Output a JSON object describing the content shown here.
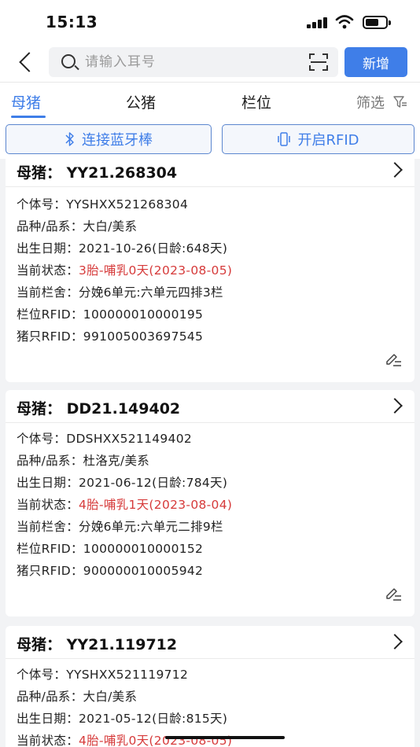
{
  "status_bar": {
    "time": "15:13"
  },
  "search": {
    "placeholder": "请输入耳号",
    "add_label": "新增"
  },
  "tabs": {
    "items": [
      "母猪",
      "公猪",
      "栏位"
    ],
    "active": "母猪",
    "filter_label": "筛选"
  },
  "actions": {
    "bluetooth_label": "连接蓝牙棒",
    "rfid_label": "开启RFID"
  },
  "colors": {
    "accent": "#3f7ee8",
    "status_red": "#d63a3a"
  },
  "labels": {
    "id": "个体号：",
    "breed": "品种/品系：",
    "birth": "出生日期：",
    "status": "当前状态：",
    "pen": "当前栏舍：",
    "pen_rfid": "栏位RFID：",
    "pig_rfid": "猪只RFID："
  },
  "cards": [
    {
      "title": "母猪：  YY21.268304",
      "id": "YYSHXX521268304",
      "breed": "大白/美系",
      "birth": "2021-10-26(日龄:648天)",
      "status": "3胎-哺乳0天(2023-08-05)",
      "pen": "分娩6单元:六单元四排3栏",
      "pen_rfid": "100000010000195",
      "pig_rfid": "991005003697545"
    },
    {
      "title": "母猪：  DD21.149402",
      "id": "DDSHXX521149402",
      "breed": "杜洛克/美系",
      "birth": "2021-06-12(日龄:784天)",
      "status": "4胎-哺乳1天(2023-08-04)",
      "pen": "分娩6单元:六单元二排9栏",
      "pen_rfid": "100000010000152",
      "pig_rfid": "900000010005942"
    },
    {
      "title": "母猪：  YY21.119712",
      "id": "YYSHXX521119712",
      "breed": "大白/美系",
      "birth": "2021-05-12(日龄:815天)",
      "status": "4胎-哺乳0天(2023-08-05)"
    }
  ]
}
